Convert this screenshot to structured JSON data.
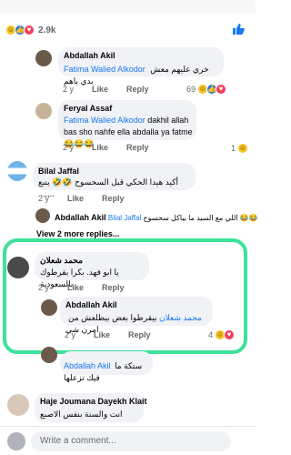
{
  "reactions": {
    "count": "2.9k"
  },
  "comments": [
    {
      "name": "Abdallah Akil",
      "mention": "Fatima Walied Alkodor",
      "text": "خري عليهم معش بدي ياهم",
      "time": "2 y",
      "like": "Like",
      "reply": "Reply",
      "reactions": "69"
    },
    {
      "name": "Feryal Assaf",
      "mention": "Fatima Walied Alkodor",
      "text": " dakhil allah bas sho nahfe ella abdalla ya fatme😂😂😂",
      "time": "2 y",
      "like": "Like",
      "reply": "Reply",
      "reactions": "1"
    },
    {
      "name": "Bilal Jaffal",
      "text": "أكيد هيدا الحكي قبل السحسوح 🤣🤣 ينبع .......",
      "time": "2 y",
      "like": "Like",
      "reply": "Reply"
    },
    {
      "name": "Abdallah Akil",
      "mention": "Bilal Jaffal",
      "text": "اللي مع السيد ما بياكل سحسوح 😂😂"
    },
    {
      "view_more": "View 2 more replies..."
    },
    {
      "name": "محمد شعلان",
      "text": "يا ابو فهد. بكرا بقرطوك بالسعودية",
      "time": "2 y",
      "like": "Like",
      "reply": "Reply"
    },
    {
      "name": "Abdallah Akil",
      "mention": "محمد شعلان",
      "text": "بيقرطوا بعض بيطلعش من امرن شي",
      "time": "2 y",
      "like": "Like",
      "reply": "Reply",
      "reactions": "4"
    },
    {
      "mention": "Abdallah Akil",
      "text": "ستكة ما فيك تزعلها"
    },
    {
      "name": "Haje Joumana Dayekh Klait",
      "text": "انت والسنة بنفس الاصبع"
    }
  ],
  "composer": {
    "placeholder": "Write a comment..."
  }
}
